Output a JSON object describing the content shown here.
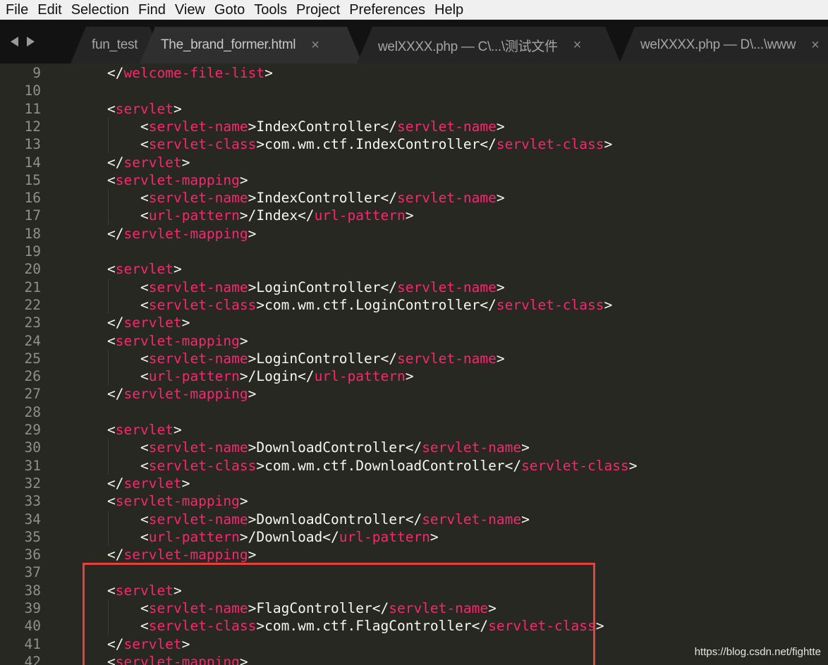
{
  "menu": [
    "File",
    "Edit",
    "Selection",
    "Find",
    "View",
    "Goto",
    "Tools",
    "Project",
    "Preferences",
    "Help"
  ],
  "tabs": [
    {
      "label": "fun_test",
      "close": ""
    },
    {
      "label": "The_brand_former.html",
      "close": "×"
    },
    {
      "label": "welXXXX.php — C\\...\\测试文件",
      "close": "×"
    },
    {
      "label": "welXXXX.php — D\\...\\www",
      "close": "×"
    }
  ],
  "lines": [
    {
      "n": "9",
      "indent": 0,
      "parts": [
        {
          "k": "b",
          "v": "</"
        },
        {
          "k": "t",
          "v": "welcome-file-list"
        },
        {
          "k": "b",
          "v": ">"
        }
      ]
    },
    {
      "n": "10",
      "indent": 0,
      "parts": []
    },
    {
      "n": "11",
      "indent": 0,
      "parts": [
        {
          "k": "b",
          "v": "<"
        },
        {
          "k": "t",
          "v": "servlet"
        },
        {
          "k": "b",
          "v": ">"
        }
      ]
    },
    {
      "n": "12",
      "indent": 1,
      "parts": [
        {
          "k": "b",
          "v": "<"
        },
        {
          "k": "t",
          "v": "servlet-name"
        },
        {
          "k": "b",
          "v": ">IndexController</"
        },
        {
          "k": "t",
          "v": "servlet-name"
        },
        {
          "k": "b",
          "v": ">"
        }
      ]
    },
    {
      "n": "13",
      "indent": 1,
      "parts": [
        {
          "k": "b",
          "v": "<"
        },
        {
          "k": "t",
          "v": "servlet-class"
        },
        {
          "k": "b",
          "v": ">com.wm.ctf.IndexController</"
        },
        {
          "k": "t",
          "v": "servlet-class"
        },
        {
          "k": "b",
          "v": ">"
        }
      ]
    },
    {
      "n": "14",
      "indent": 0,
      "parts": [
        {
          "k": "b",
          "v": "</"
        },
        {
          "k": "t",
          "v": "servlet"
        },
        {
          "k": "b",
          "v": ">"
        }
      ]
    },
    {
      "n": "15",
      "indent": 0,
      "parts": [
        {
          "k": "b",
          "v": "<"
        },
        {
          "k": "t",
          "v": "servlet-mapping"
        },
        {
          "k": "b",
          "v": ">"
        }
      ]
    },
    {
      "n": "16",
      "indent": 1,
      "parts": [
        {
          "k": "b",
          "v": "<"
        },
        {
          "k": "t",
          "v": "servlet-name"
        },
        {
          "k": "b",
          "v": ">IndexController</"
        },
        {
          "k": "t",
          "v": "servlet-name"
        },
        {
          "k": "b",
          "v": ">"
        }
      ]
    },
    {
      "n": "17",
      "indent": 1,
      "parts": [
        {
          "k": "b",
          "v": "<"
        },
        {
          "k": "t",
          "v": "url-pattern"
        },
        {
          "k": "b",
          "v": ">/Index</"
        },
        {
          "k": "t",
          "v": "url-pattern"
        },
        {
          "k": "b",
          "v": ">"
        }
      ]
    },
    {
      "n": "18",
      "indent": 0,
      "parts": [
        {
          "k": "b",
          "v": "</"
        },
        {
          "k": "t",
          "v": "servlet-mapping"
        },
        {
          "k": "b",
          "v": ">"
        }
      ]
    },
    {
      "n": "19",
      "indent": 0,
      "parts": []
    },
    {
      "n": "20",
      "indent": 0,
      "parts": [
        {
          "k": "b",
          "v": "<"
        },
        {
          "k": "t",
          "v": "servlet"
        },
        {
          "k": "b",
          "v": ">"
        }
      ]
    },
    {
      "n": "21",
      "indent": 1,
      "parts": [
        {
          "k": "b",
          "v": "<"
        },
        {
          "k": "t",
          "v": "servlet-name"
        },
        {
          "k": "b",
          "v": ">LoginController</"
        },
        {
          "k": "t",
          "v": "servlet-name"
        },
        {
          "k": "b",
          "v": ">"
        }
      ]
    },
    {
      "n": "22",
      "indent": 1,
      "parts": [
        {
          "k": "b",
          "v": "<"
        },
        {
          "k": "t",
          "v": "servlet-class"
        },
        {
          "k": "b",
          "v": ">com.wm.ctf.LoginController</"
        },
        {
          "k": "t",
          "v": "servlet-class"
        },
        {
          "k": "b",
          "v": ">"
        }
      ]
    },
    {
      "n": "23",
      "indent": 0,
      "parts": [
        {
          "k": "b",
          "v": "</"
        },
        {
          "k": "t",
          "v": "servlet"
        },
        {
          "k": "b",
          "v": ">"
        }
      ]
    },
    {
      "n": "24",
      "indent": 0,
      "parts": [
        {
          "k": "b",
          "v": "<"
        },
        {
          "k": "t",
          "v": "servlet-mapping"
        },
        {
          "k": "b",
          "v": ">"
        }
      ]
    },
    {
      "n": "25",
      "indent": 1,
      "parts": [
        {
          "k": "b",
          "v": "<"
        },
        {
          "k": "t",
          "v": "servlet-name"
        },
        {
          "k": "b",
          "v": ">LoginController</"
        },
        {
          "k": "t",
          "v": "servlet-name"
        },
        {
          "k": "b",
          "v": ">"
        }
      ]
    },
    {
      "n": "26",
      "indent": 1,
      "parts": [
        {
          "k": "b",
          "v": "<"
        },
        {
          "k": "t",
          "v": "url-pattern"
        },
        {
          "k": "b",
          "v": ">/Login</"
        },
        {
          "k": "t",
          "v": "url-pattern"
        },
        {
          "k": "b",
          "v": ">"
        }
      ]
    },
    {
      "n": "27",
      "indent": 0,
      "parts": [
        {
          "k": "b",
          "v": "</"
        },
        {
          "k": "t",
          "v": "servlet-mapping"
        },
        {
          "k": "b",
          "v": ">"
        }
      ]
    },
    {
      "n": "28",
      "indent": 0,
      "parts": []
    },
    {
      "n": "29",
      "indent": 0,
      "parts": [
        {
          "k": "b",
          "v": "<"
        },
        {
          "k": "t",
          "v": "servlet"
        },
        {
          "k": "b",
          "v": ">"
        }
      ]
    },
    {
      "n": "30",
      "indent": 1,
      "parts": [
        {
          "k": "b",
          "v": "<"
        },
        {
          "k": "t",
          "v": "servlet-name"
        },
        {
          "k": "b",
          "v": ">DownloadController</"
        },
        {
          "k": "t",
          "v": "servlet-name"
        },
        {
          "k": "b",
          "v": ">"
        }
      ]
    },
    {
      "n": "31",
      "indent": 1,
      "parts": [
        {
          "k": "b",
          "v": "<"
        },
        {
          "k": "t",
          "v": "servlet-class"
        },
        {
          "k": "b",
          "v": ">com.wm.ctf.DownloadController</"
        },
        {
          "k": "t",
          "v": "servlet-class"
        },
        {
          "k": "b",
          "v": ">"
        }
      ]
    },
    {
      "n": "32",
      "indent": 0,
      "parts": [
        {
          "k": "b",
          "v": "</"
        },
        {
          "k": "t",
          "v": "servlet"
        },
        {
          "k": "b",
          "v": ">"
        }
      ]
    },
    {
      "n": "33",
      "indent": 0,
      "parts": [
        {
          "k": "b",
          "v": "<"
        },
        {
          "k": "t",
          "v": "servlet-mapping"
        },
        {
          "k": "b",
          "v": ">"
        }
      ]
    },
    {
      "n": "34",
      "indent": 1,
      "parts": [
        {
          "k": "b",
          "v": "<"
        },
        {
          "k": "t",
          "v": "servlet-name"
        },
        {
          "k": "b",
          "v": ">DownloadController</"
        },
        {
          "k": "t",
          "v": "servlet-name"
        },
        {
          "k": "b",
          "v": ">"
        }
      ]
    },
    {
      "n": "35",
      "indent": 1,
      "parts": [
        {
          "k": "b",
          "v": "<"
        },
        {
          "k": "t",
          "v": "url-pattern"
        },
        {
          "k": "b",
          "v": ">/Download</"
        },
        {
          "k": "t",
          "v": "url-pattern"
        },
        {
          "k": "b",
          "v": ">"
        }
      ]
    },
    {
      "n": "36",
      "indent": 0,
      "parts": [
        {
          "k": "b",
          "v": "</"
        },
        {
          "k": "t",
          "v": "servlet-mapping"
        },
        {
          "k": "b",
          "v": ">"
        }
      ]
    },
    {
      "n": "37",
      "indent": 0,
      "parts": []
    },
    {
      "n": "38",
      "indent": 0,
      "parts": [
        {
          "k": "b",
          "v": "<"
        },
        {
          "k": "t",
          "v": "servlet"
        },
        {
          "k": "b",
          "v": ">"
        }
      ]
    },
    {
      "n": "39",
      "indent": 1,
      "parts": [
        {
          "k": "b",
          "v": "<"
        },
        {
          "k": "t",
          "v": "servlet-name"
        },
        {
          "k": "b",
          "v": ">FlagController</"
        },
        {
          "k": "t",
          "v": "servlet-name"
        },
        {
          "k": "b",
          "v": ">"
        }
      ]
    },
    {
      "n": "40",
      "indent": 1,
      "parts": [
        {
          "k": "b",
          "v": "<"
        },
        {
          "k": "t",
          "v": "servlet-class"
        },
        {
          "k": "b",
          "v": ">com.wm.ctf.FlagController</"
        },
        {
          "k": "t",
          "v": "servlet-class"
        },
        {
          "k": "b",
          "v": ">"
        }
      ]
    },
    {
      "n": "41",
      "indent": 0,
      "parts": [
        {
          "k": "b",
          "v": "</"
        },
        {
          "k": "t",
          "v": "servlet"
        },
        {
          "k": "b",
          "v": ">"
        }
      ]
    },
    {
      "n": "42",
      "indent": 0,
      "parts": [
        {
          "k": "b",
          "v": "<"
        },
        {
          "k": "t",
          "v": "servlet-mapping"
        },
        {
          "k": "b",
          "v": ">"
        }
      ]
    }
  ],
  "watermark": "https://blog.csdn.net/fightte",
  "colors": {
    "background": "#272822",
    "tag": "#f92672",
    "text": "#f8f8f2",
    "line_number": "#8f908a",
    "highlight_box": "#e8413a"
  },
  "icons": {
    "nav_left": "triangle-left-icon",
    "nav_right": "triangle-right-icon",
    "tab_close": "close-icon"
  }
}
